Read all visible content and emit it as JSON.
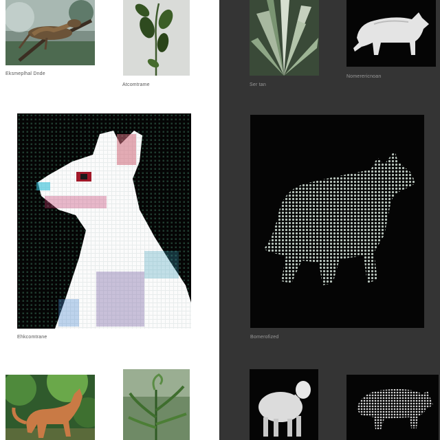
{
  "colors": {
    "left_panel_bg": "#ffffff",
    "right_panel_bg": "#343434",
    "tile_black": "#050505"
  },
  "left_panel": {
    "items": [
      {
        "image": "lizard-on-branch-photo",
        "caption": "Eksmeplhal Dnde"
      },
      {
        "image": "plant-sprout-photo",
        "caption": "Atcomtrame"
      },
      {
        "image": "pixel-llama-artwork",
        "caption": "Ehkcomtrane"
      },
      {
        "image": "fox-in-jungle-photo",
        "caption": ""
      },
      {
        "image": "fern-plant-photo",
        "caption": ""
      }
    ]
  },
  "right_panel": {
    "items": [
      {
        "image": "agave-leaves-photo",
        "caption": "Ser tan"
      },
      {
        "image": "white-hyena-sculpture",
        "caption": "Nomerericnoan"
      },
      {
        "image": "dotted-bear-artwork",
        "caption": "Bomerofized"
      },
      {
        "image": "white-sheep-sculpture",
        "caption": ""
      },
      {
        "image": "dotted-pig-artwork",
        "caption": ""
      }
    ]
  }
}
